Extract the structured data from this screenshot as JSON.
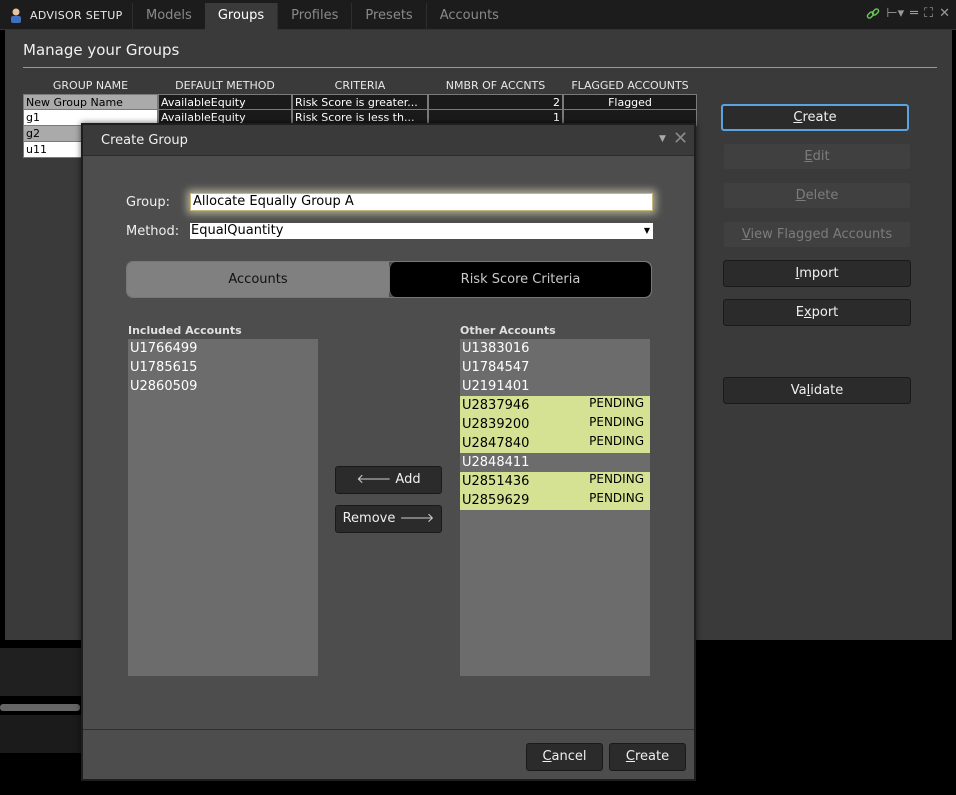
{
  "app": {
    "title": "ADVISOR SETUP"
  },
  "tabs": [
    {
      "label": "Models"
    },
    {
      "label": "Groups"
    },
    {
      "label": "Profiles"
    },
    {
      "label": "Presets"
    },
    {
      "label": "Accounts"
    }
  ],
  "page": {
    "title": "Manage your Groups"
  },
  "groups_table": {
    "columns": [
      "GROUP NAME",
      "DEFAULT METHOD",
      "CRITERIA",
      "NMBR OF ACCNTS",
      "FLAGGED ACCOUNTS"
    ],
    "rows": [
      {
        "name": "New Group Name",
        "method": "AvailableEquity",
        "criteria": "Risk Score is greater...",
        "count": "2",
        "flagged": "Flagged"
      },
      {
        "name": "g1",
        "method": "AvailableEquity",
        "criteria": "Risk Score is less th...",
        "count": "1",
        "flagged": ""
      },
      {
        "name": "g2",
        "method": "",
        "criteria": "",
        "count": "",
        "flagged": ""
      },
      {
        "name": "u11",
        "method": "",
        "criteria": "",
        "count": "",
        "flagged": ""
      }
    ]
  },
  "side_buttons": {
    "create": {
      "pre": "",
      "u": "C",
      "post": "reate"
    },
    "edit": {
      "pre": "",
      "u": "E",
      "post": "dit"
    },
    "delete": {
      "pre": "",
      "u": "D",
      "post": "elete"
    },
    "view_flagged": {
      "pre": "",
      "u": "V",
      "post": "iew Flagged Accounts"
    },
    "import": {
      "pre": "",
      "u": "I",
      "post": "mport"
    },
    "export": {
      "pre": "E",
      "u": "x",
      "post": "port"
    },
    "validate": {
      "pre": "Va",
      "u": "l",
      "post": "idate"
    }
  },
  "dialog": {
    "title": "Create Group",
    "group_label": "Group:",
    "group_value": "Allocate Equally Group A",
    "method_label": "Method:",
    "method_value": "EqualQuantity",
    "seg_accounts": "Accounts",
    "seg_risk": "Risk Score Criteria",
    "included_header": "Included Accounts",
    "other_header": "Other Accounts",
    "included": [
      {
        "id": "U1766499"
      },
      {
        "id": "U1785615"
      },
      {
        "id": "U2860509"
      }
    ],
    "other": [
      {
        "id": "U1383016",
        "status": ""
      },
      {
        "id": "U1784547",
        "status": ""
      },
      {
        "id": "U2191401",
        "status": ""
      },
      {
        "id": "U2837946",
        "status": "PENDING"
      },
      {
        "id": "U2839200",
        "status": "PENDING"
      },
      {
        "id": "U2847840",
        "status": "PENDING"
      },
      {
        "id": "U2848411",
        "status": ""
      },
      {
        "id": "U2851436",
        "status": "PENDING"
      },
      {
        "id": "U2859629",
        "status": "PENDING"
      }
    ],
    "add_label": "Add",
    "remove_label": "Remove",
    "cancel": {
      "pre": "",
      "u": "C",
      "post": "ancel"
    },
    "create": {
      "pre": "",
      "u": "C",
      "post": "reate"
    }
  },
  "colors": {
    "pending_highlight": "#d5e294",
    "focus_border": "#5aa2e0",
    "panel": "#3a3a3a",
    "dialog": "#4d4d4d"
  },
  "icons": [
    "advisor-logo-icon",
    "link-icon",
    "pin-icon",
    "minimize-icon",
    "maximize-icon",
    "close-icon",
    "dropdown-arrow-icon",
    "arrow-left-icon",
    "arrow-right-icon"
  ]
}
